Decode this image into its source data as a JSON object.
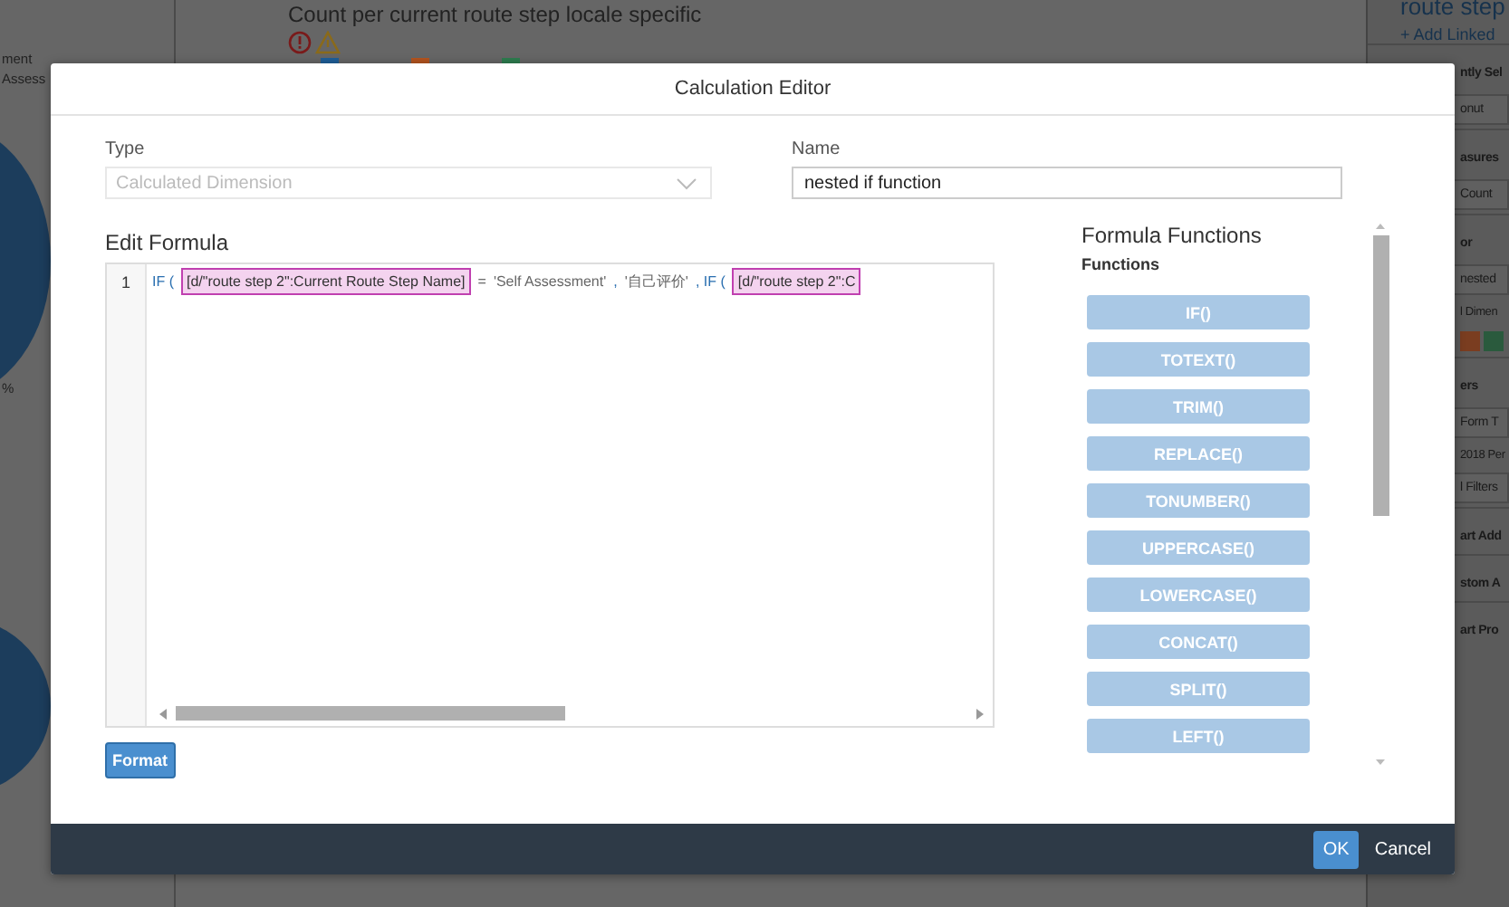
{
  "background": {
    "chart_title": "Count per current route step locale specific",
    "left_labels": [
      "ment",
      "Assess"
    ],
    "percent": "%",
    "panel": {
      "title": "route step",
      "add_link": "+ Add Linked",
      "items": [
        {
          "kind": "heading",
          "text": "ntly Sel"
        },
        {
          "kind": "row",
          "text": "onut"
        },
        {
          "kind": "heading",
          "text": "asures"
        },
        {
          "kind": "row",
          "text": "Count"
        },
        {
          "kind": "heading",
          "text": "or"
        },
        {
          "kind": "row",
          "text": "nested"
        },
        {
          "kind": "sub",
          "text": "l Dimen"
        },
        {
          "kind": "swatches"
        },
        {
          "kind": "heading",
          "text": "ers"
        },
        {
          "kind": "row",
          "text": "Form T"
        },
        {
          "kind": "sub",
          "text": "2018 Per"
        },
        {
          "kind": "row",
          "text": "l Filters"
        },
        {
          "kind": "heading",
          "text": "art Add"
        },
        {
          "kind": "heading",
          "text": "stom A"
        },
        {
          "kind": "heading",
          "text": "art Pro"
        }
      ]
    }
  },
  "dialog": {
    "title": "Calculation Editor",
    "type": {
      "label": "Type",
      "value": "Calculated Dimension",
      "disabled": true
    },
    "name": {
      "label": "Name",
      "value": "nested if function"
    },
    "editor": {
      "title": "Edit Formula",
      "line_number": "1",
      "tokens": [
        {
          "kind": "keyword",
          "text": "IF ("
        },
        {
          "kind": "field",
          "text": "[d/\"route step 2\":Current Route Step Name]"
        },
        {
          "kind": "operator",
          "text": "="
        },
        {
          "kind": "string",
          "text": "'Self Assessment'"
        },
        {
          "kind": "keyword",
          "text": ","
        },
        {
          "kind": "string",
          "text": "'自己评价'"
        },
        {
          "kind": "keyword",
          "text": ", IF ("
        },
        {
          "kind": "field",
          "text": "[d/\"route step 2\":C"
        }
      ],
      "format_button": "Format"
    },
    "functions": {
      "title": "Formula Functions",
      "subtitle": "Functions",
      "items": [
        "IF()",
        "TOTEXT()",
        "TRIM()",
        "REPLACE()",
        "TONUMBER()",
        "UPPERCASE()",
        "LOWERCASE()",
        "CONCAT()",
        "SPLIT()",
        "LEFT()"
      ]
    },
    "buttons": [
      {
        "label": "OK",
        "kind": "primary"
      },
      {
        "label": "Cancel",
        "kind": "plain"
      }
    ]
  }
}
